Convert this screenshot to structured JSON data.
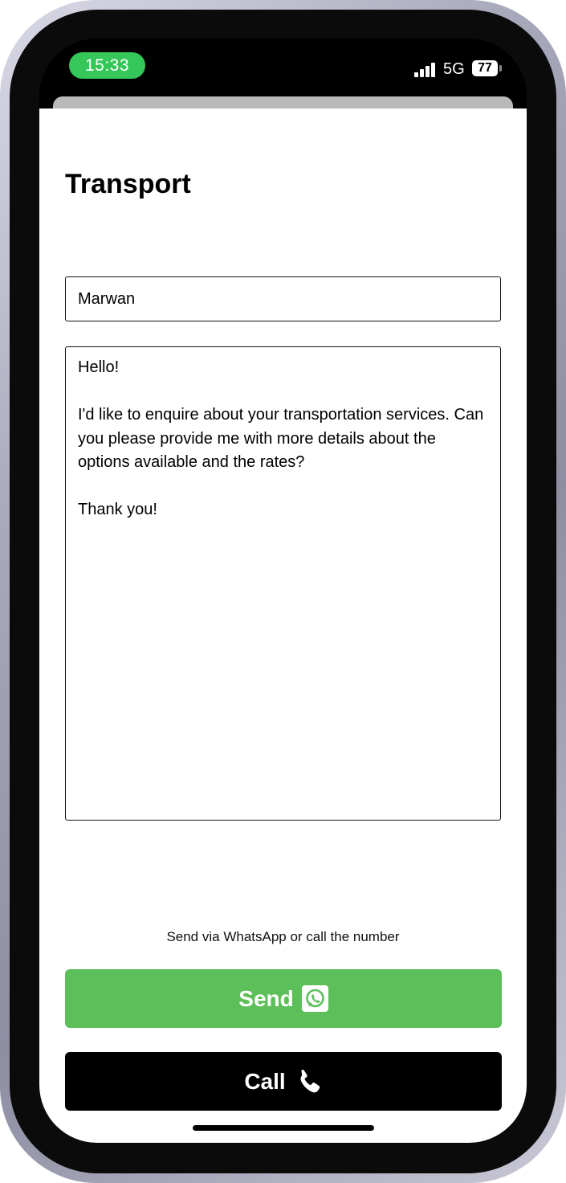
{
  "status_bar": {
    "time": "15:33",
    "network": "5G",
    "battery": "77"
  },
  "page": {
    "title": "Transport"
  },
  "form": {
    "name_value": "Marwan",
    "message_value": "Hello!\n\nI'd like to enquire about your transportation services. Can you please provide me with more details about the options available and the rates?\n\nThank you!"
  },
  "hint": "Send via WhatsApp or call the number",
  "buttons": {
    "send_label": "Send",
    "send_icon": "whatsapp-icon",
    "call_label": "Call",
    "call_icon": "phone-icon"
  },
  "colors": {
    "send_button": "#5cbf5a",
    "call_button": "#000000",
    "time_pill": "#35c759"
  }
}
